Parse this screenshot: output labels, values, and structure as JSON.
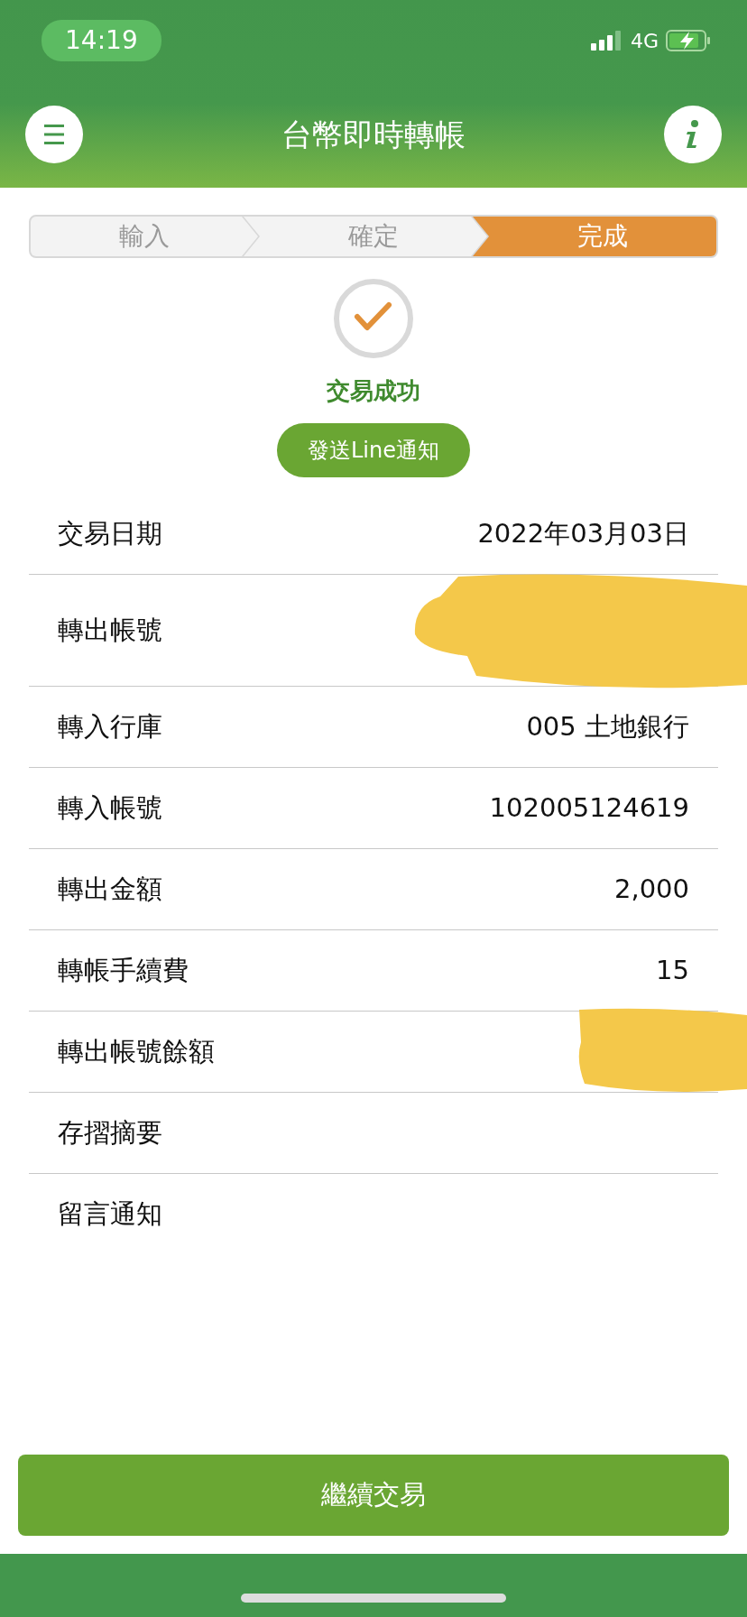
{
  "status_bar": {
    "time": "14:19",
    "network": "4G"
  },
  "header": {
    "title": "台幣即時轉帳"
  },
  "steps": [
    {
      "label": "輸入",
      "selected": false
    },
    {
      "label": "確定",
      "selected": false
    },
    {
      "label": "完成",
      "selected": true
    }
  ],
  "result": {
    "message": "交易成功",
    "line_button": "發送Line通知"
  },
  "rows": [
    {
      "label": "交易日期",
      "value": "2022年03月03日",
      "redacted": false,
      "tall": false
    },
    {
      "label": "轉出帳號",
      "redacted": true,
      "tall": true
    },
    {
      "label": "轉入行庫",
      "value": "005  土地銀行",
      "redacted": false,
      "tall": false
    },
    {
      "label": "轉入帳號",
      "value": "102005124619",
      "redacted": false,
      "tall": false
    },
    {
      "label": "轉出金額",
      "value": "2,000",
      "redacted": false,
      "tall": false
    },
    {
      "label": "轉帳手續費",
      "value": "15",
      "redacted": false,
      "tall": false
    },
    {
      "label": "轉出帳號餘額",
      "redacted": true,
      "tall": false
    },
    {
      "label": "存摺摘要",
      "redacted": false,
      "tall": false
    },
    {
      "label": "留言通知",
      "redacted": false,
      "tall": false
    }
  ],
  "continue_button": "繼續交易"
}
